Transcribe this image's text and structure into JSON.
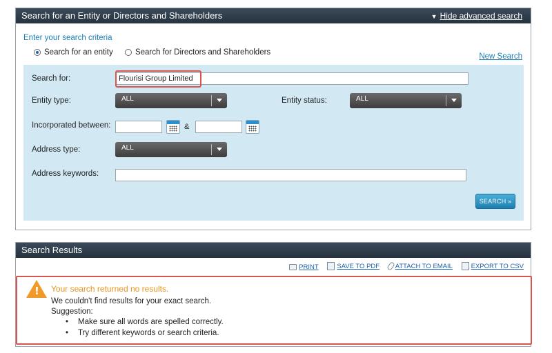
{
  "search_panel": {
    "title": "Search for an Entity or Directors and Shareholders",
    "hide_advanced_label": "Hide advanced search",
    "criteria_label": "Enter your search criteria",
    "radio_entity": "Search for an entity",
    "radio_directors": "Search for Directors and Shareholders",
    "selected_radio": "entity",
    "new_search_label": "New Search",
    "search_for_label": "Search for:",
    "search_for_value": "Flourisi Group Limited",
    "entity_type_label": "Entity type:",
    "entity_type_value": "ALL",
    "entity_status_label": "Entity status:",
    "entity_status_value": "ALL",
    "incorporated_label": "Incorporated between:",
    "incorporated_from": "",
    "incorporated_to": "",
    "amp": "&",
    "address_type_label": "Address type:",
    "address_type_value": "ALL",
    "address_keywords_label": "Address keywords:",
    "address_keywords_value": "",
    "search_button": "SEARCH »"
  },
  "results_panel": {
    "title": "Search Results",
    "tools": {
      "print": "PRINT",
      "save_pdf": "SAVE TO PDF",
      "attach_email": "ATTACH TO EMAIL",
      "export_csv": "EXPORT TO CSV"
    },
    "alert": {
      "title": "Your search returned no results.",
      "line1": "We couldn't find results for your exact search.",
      "line2": "Suggestion:",
      "bullets": [
        "Make sure all words are spelled correctly.",
        "Try different keywords or search criteria."
      ]
    }
  },
  "colors": {
    "header_bg": "#26333f",
    "form_bg": "#d2e9f4",
    "link": "#1a7fb5",
    "highlight_border": "#d9534f",
    "warning": "#f19a28"
  }
}
